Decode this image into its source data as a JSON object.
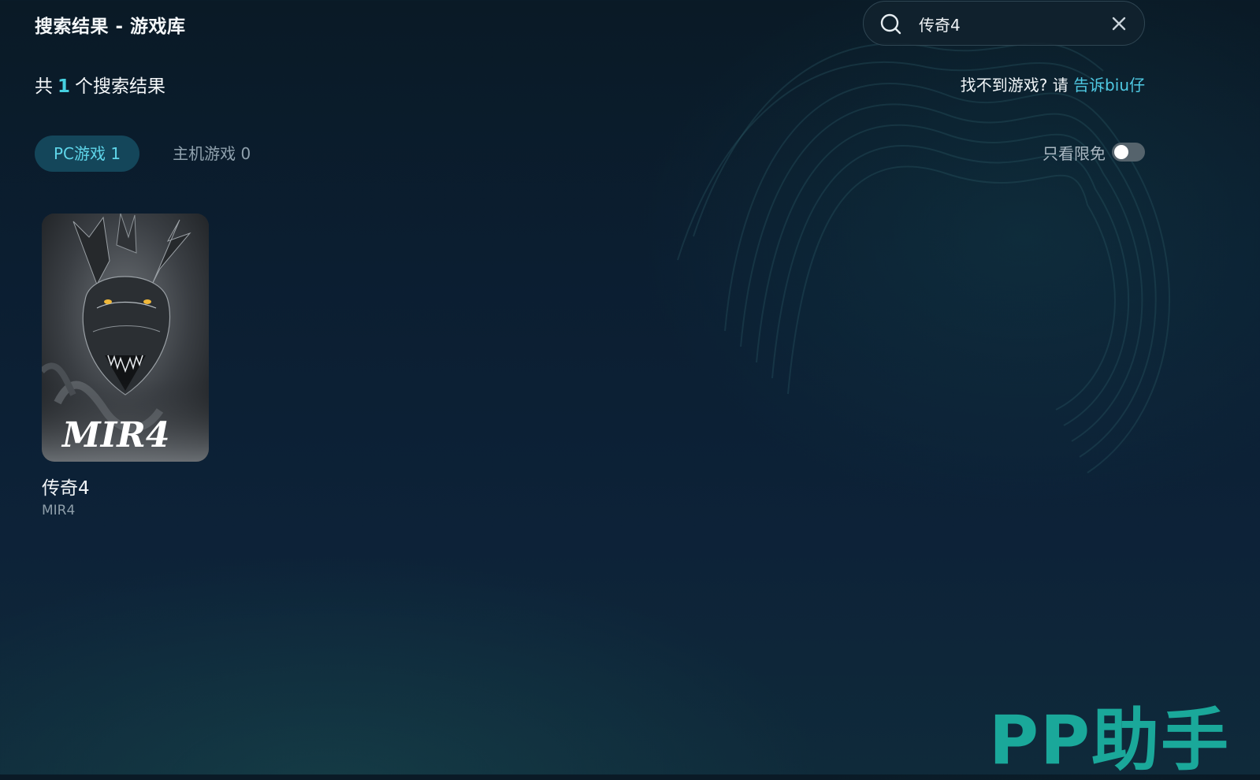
{
  "header": {
    "title": "搜索结果 - 游戏库"
  },
  "search": {
    "value": "传奇4",
    "placeholder": ""
  },
  "summary": {
    "prefix": "共",
    "count": "1",
    "suffix": "个搜索结果"
  },
  "feedback": {
    "text": "找不到游戏? 请",
    "link": "告诉biu仔"
  },
  "tabs": [
    {
      "label": "PC游戏 1",
      "active": true
    },
    {
      "label": "主机游戏 0",
      "active": false
    }
  ],
  "filter": {
    "label": "只看限免",
    "enabled": false
  },
  "results": [
    {
      "name": "传奇4",
      "subtitle": "MIR4",
      "cover_logo": "MIR4"
    }
  ],
  "brand": {
    "logo_text": "PP助手"
  },
  "colors": {
    "accent": "#46d0e0",
    "link": "#4fc9e3",
    "tab_active_bg": "#14465a",
    "brand": "#1aa89a"
  }
}
